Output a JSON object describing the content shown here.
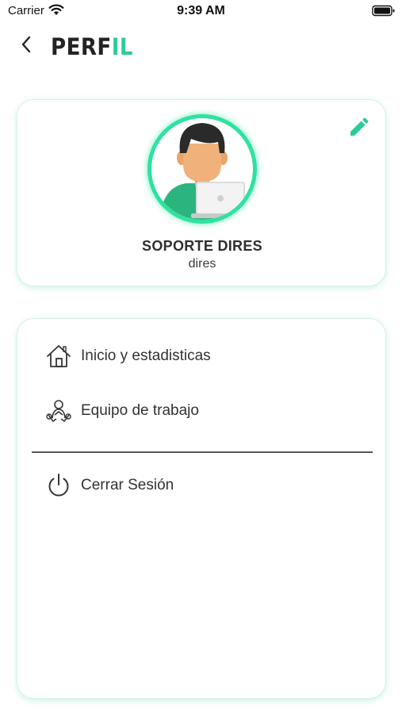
{
  "status_bar": {
    "carrier": "Carrier",
    "time": "9:39 AM",
    "icons": [
      "wifi-icon",
      "battery-icon"
    ]
  },
  "header": {
    "title_part1": "PERF",
    "title_part2": "IL",
    "back_icon": "chevron-left-icon",
    "accent_color": "#2ecc94"
  },
  "profile": {
    "name": "SOPORTE DIRES",
    "username": "dires",
    "avatar_icon": "user-avatar-icon",
    "edit_icon": "pencil-icon",
    "ring_color": "#2ee2a0"
  },
  "menu": {
    "items": [
      {
        "label": "Inicio y estadisticas",
        "icon": "home-icon"
      },
      {
        "label": "Equipo de trabajo",
        "icon": "team-icon"
      }
    ],
    "logout": {
      "label": "Cerrar Sesión",
      "icon": "power-icon"
    }
  }
}
